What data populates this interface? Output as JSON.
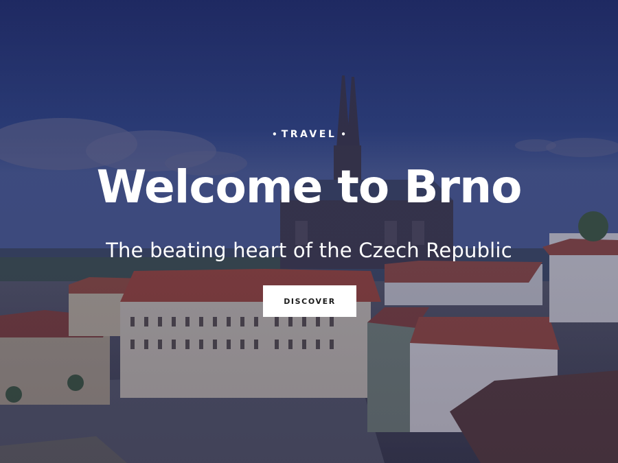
{
  "hero": {
    "eyebrow": "TRAVEL",
    "eyebrow_bullet": "•",
    "headline": "Welcome to Brno",
    "subtitle": "The beating heart of the Czech Republic",
    "cta_label": "DISCOVER"
  },
  "colors": {
    "overlay": "#23285a",
    "sky_top": "#1e2d6e",
    "roof_red": "#a8442e",
    "button_bg": "#ffffff",
    "button_text": "#1a1a1a",
    "text": "#ffffff"
  },
  "background_image": "photo of Brno old town rooftops with cathedral under blue sky"
}
